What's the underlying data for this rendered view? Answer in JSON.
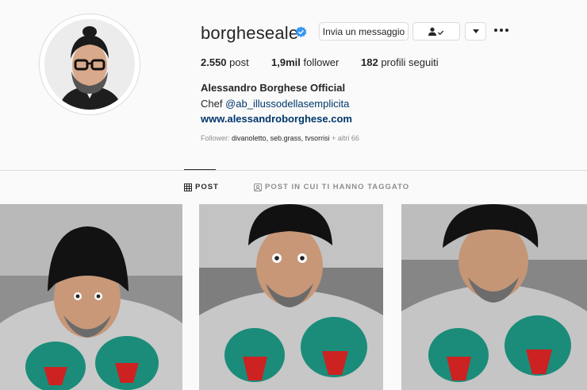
{
  "profile": {
    "username": "borgheseale",
    "verified": true,
    "accent_color": "#3897f0",
    "buttons": {
      "message_label": "Invia un messaggio",
      "following_icon": "person-check-icon",
      "dropdown_icon": "chevron-down-icon",
      "more_icon": "more-horizontal-icon"
    },
    "stats": {
      "posts_value": "2.550",
      "posts_label": "post",
      "followers_value": "1,9mil",
      "followers_label": "follower",
      "following_value": "182",
      "following_label": "profili seguiti"
    },
    "full_name": "Alessandro Borghese Official",
    "bio_prefix": "Chef",
    "bio_mention": "@ab_illussodellasemplicita",
    "website": "www.alessandroborghese.com",
    "followed_by": {
      "prefix": "Follower:",
      "names": [
        "divanoletto,",
        "seb.grass,",
        "tvsorrisi"
      ],
      "suffix": "+ altri 66"
    }
  },
  "tabs": [
    {
      "label": "POST",
      "icon": "grid-icon",
      "active": true
    },
    {
      "label": "POST IN CUI TI HANNO TAGGATO",
      "icon": "tag-person-icon",
      "active": false
    }
  ],
  "posts": [
    {
      "alt": "selfie-1"
    },
    {
      "alt": "selfie-2"
    },
    {
      "alt": "selfie-3"
    }
  ]
}
